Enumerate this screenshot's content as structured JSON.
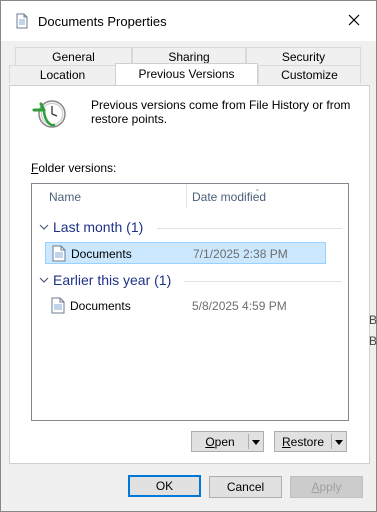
{
  "window": {
    "title": "Documents Properties"
  },
  "tabs": {
    "row1": [
      "General",
      "Sharing",
      "Security"
    ],
    "row2": [
      "Location",
      "Previous Versions",
      "Customize"
    ],
    "active": "Previous Versions"
  },
  "info": {
    "text": "Previous versions come from File History or from restore points."
  },
  "folder_versions": {
    "label_prefix": "F",
    "label_rest": "older versions:"
  },
  "columns": {
    "name": "Name",
    "date": "Date modified"
  },
  "groups": [
    {
      "title": "Last month (1)",
      "items": [
        {
          "name": "Documents",
          "date": "7/1/2025 2:38 PM",
          "selected": true
        }
      ]
    },
    {
      "title": "Earlier this year (1)",
      "items": [
        {
          "name": "Documents",
          "date": "5/8/2025 4:59 PM",
          "selected": false
        }
      ]
    }
  ],
  "actions": {
    "open": {
      "underlined": "O",
      "rest": "pen"
    },
    "restore": {
      "underlined": "R",
      "rest": "estore"
    }
  },
  "footer": {
    "ok": "OK",
    "cancel": "Cancel",
    "apply": {
      "underlined": "A",
      "rest": "pply"
    }
  },
  "background_text": [
    "B",
    "B"
  ]
}
